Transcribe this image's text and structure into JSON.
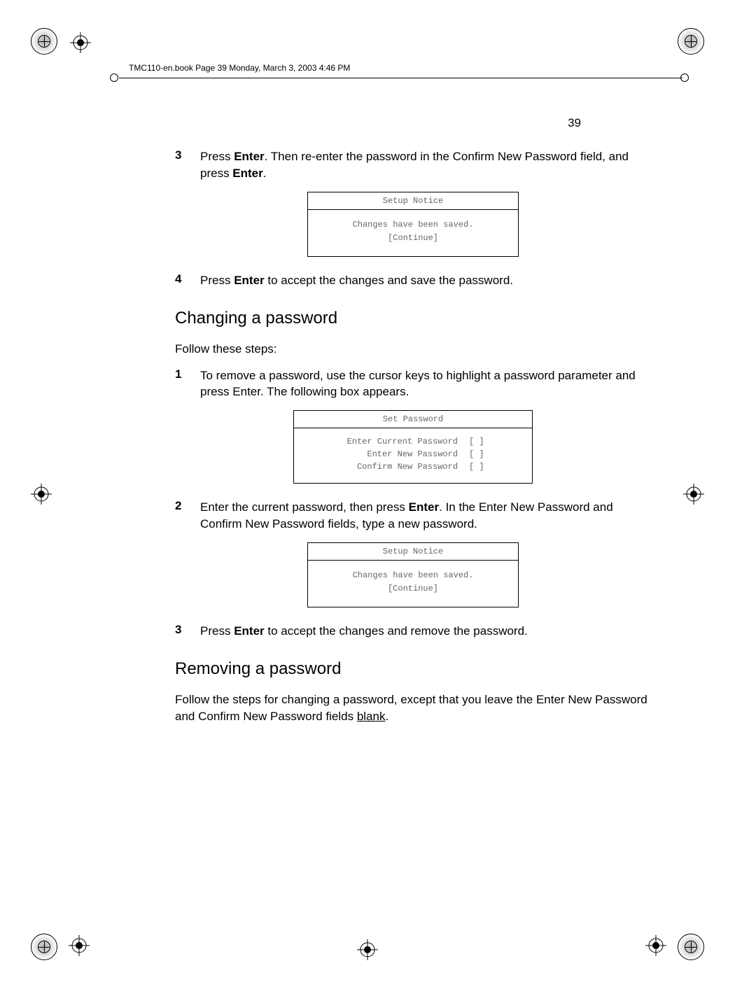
{
  "header": {
    "running_header": "TMC110-en.book  Page 39  Monday, March 3, 2003  4:46 PM",
    "page_number": "39"
  },
  "steps_top": [
    {
      "num": "3",
      "pre": "Press ",
      "b1": "Enter",
      "mid": ". Then re-enter the password in the Confirm New Password field, and press ",
      "b2": "Enter",
      "post": "."
    }
  ],
  "dialog_notice": {
    "title": "Setup Notice",
    "line1": "Changes have been saved.",
    "line2": "[Continue]"
  },
  "step4": {
    "num": "4",
    "pre": "Press ",
    "b1": "Enter",
    "post": " to accept the changes and save the password."
  },
  "section_change": {
    "heading": "Changing a password",
    "intro": "Follow these steps:"
  },
  "change_step1": {
    "num": "1",
    "text": "To remove a password, use the cursor keys to highlight a password parameter and press Enter.  The following box appears."
  },
  "dialog_set": {
    "title": "Set Password",
    "rows": [
      {
        "label": "Enter Current Password",
        "val": "[       ]"
      },
      {
        "label": "Enter New Password",
        "val": "[       ]"
      },
      {
        "label": "Confirm New Password",
        "val": "[       ]"
      }
    ]
  },
  "change_step2": {
    "num": "2",
    "pre": "Enter the current password, then press ",
    "b1": "Enter",
    "post": ".  In the Enter New Password and Confirm New Password fields, type a new password."
  },
  "change_step3": {
    "num": "3",
    "pre": "Press ",
    "b1": "Enter",
    "post": " to accept the changes and remove the password."
  },
  "section_remove": {
    "heading": "Removing a password",
    "para_pre": "Follow the steps for changing a password, except that you leave the Enter New Password and Confirm New Password fields ",
    "para_u": "blank",
    "para_post": "."
  }
}
